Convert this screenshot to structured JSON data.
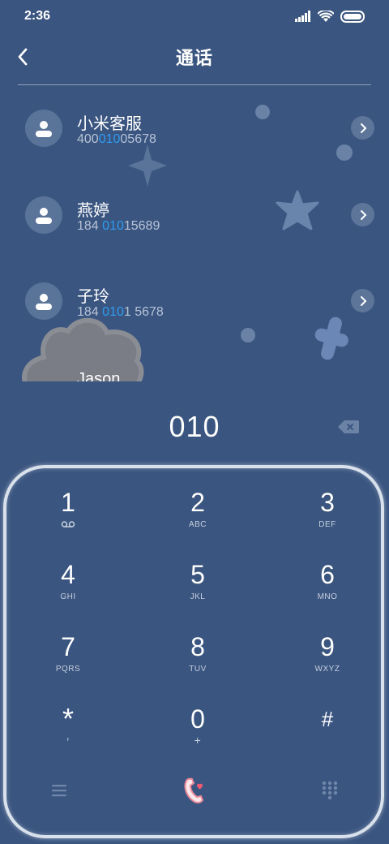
{
  "status_bar": {
    "time": "2:36"
  },
  "header": {
    "title": "通话"
  },
  "contacts": [
    {
      "name": "小米客服",
      "number_prefix": "400",
      "number_match": "010",
      "number_suffix": "05678"
    },
    {
      "name": "燕婷",
      "number_prefix": "184 ",
      "number_match": "010",
      "number_suffix": "15689"
    },
    {
      "name": "子玲",
      "number_prefix": "184 ",
      "number_match": "010",
      "number_suffix": "1 5678"
    },
    {
      "name": "Jason",
      "number_prefix": "",
      "number_match": "",
      "number_suffix": ""
    }
  ],
  "dialer": {
    "input": "010"
  },
  "keypad": {
    "k1": {
      "digit": "1",
      "sub": ""
    },
    "k2": {
      "digit": "2",
      "sub": "ABC"
    },
    "k3": {
      "digit": "3",
      "sub": "DEF"
    },
    "k4": {
      "digit": "4",
      "sub": "GHI"
    },
    "k5": {
      "digit": "5",
      "sub": "JKL"
    },
    "k6": {
      "digit": "6",
      "sub": "MNO"
    },
    "k7": {
      "digit": "7",
      "sub": "PQRS"
    },
    "k8": {
      "digit": "8",
      "sub": "TUV"
    },
    "k9": {
      "digit": "9",
      "sub": "WXYZ"
    },
    "kstar": {
      "digit": "*",
      "sub": ","
    },
    "k0": {
      "digit": "0",
      "sub": "+"
    },
    "khash": {
      "digit": "#",
      "sub": ""
    }
  },
  "icons": {
    "back": "chevron-left-icon",
    "backspace": "backspace-icon",
    "voicemail": "voicemail-icon",
    "menu": "menu-icon",
    "call": "phone-call-icon",
    "keypad_toggle": "dialpad-icon"
  },
  "colors": {
    "background": "#3a5580",
    "highlight": "#2f9cf0",
    "call_button": "#f08a9a"
  }
}
